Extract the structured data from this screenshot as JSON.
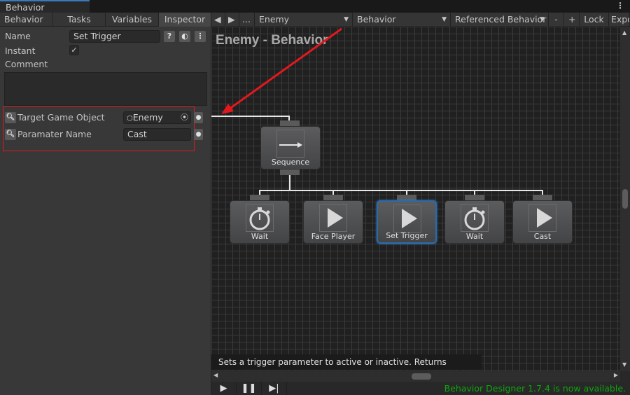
{
  "window": {
    "title": "Behavior Designer"
  },
  "toolbar": {
    "tabs": [
      "Behavior",
      "Tasks",
      "Variables",
      "Inspector"
    ],
    "prev": "◀",
    "next": "▶",
    "more": "...",
    "object_select": "Enemy",
    "behavior_select": "Behavior",
    "referenced_select": "Referenced Behavior",
    "minus": "-",
    "plus": "+",
    "lock": "Lock",
    "export": "Expo"
  },
  "inspector": {
    "name_label": "Name",
    "name_value": "Set Trigger",
    "help": "?",
    "instant_label": "Instant",
    "instant_checked": true,
    "check": "✓",
    "comment_label": "Comment",
    "comment_value": "",
    "fields": [
      {
        "label": "Target Game Object",
        "value": "Enemy"
      },
      {
        "label": "Paramater Name",
        "value": "Cast"
      }
    ]
  },
  "graph": {
    "title": "Enemy - Behavior",
    "root": "Sequence",
    "children": [
      {
        "label": "Wait",
        "icon": "stopwatch"
      },
      {
        "label": "Face Player",
        "icon": "play"
      },
      {
        "label": "Set Trigger",
        "icon": "play",
        "selected": true
      },
      {
        "label": "Wait",
        "icon": "stopwatch"
      },
      {
        "label": "Cast",
        "icon": "play"
      }
    ],
    "tooltip": "Sets a trigger parameter to active or inactive. Returns Success."
  },
  "status": {
    "update_message": "Behavior Designer 1.7.4 is now available.",
    "update_color": "#0fa40f",
    "annotation_color": "#e0191e"
  }
}
